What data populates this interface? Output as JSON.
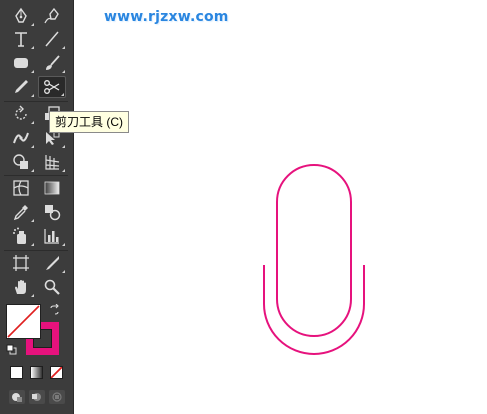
{
  "watermark": {
    "text": "www.rjzxw.com"
  },
  "tooltip": {
    "text": "剪刀工具 (C)"
  },
  "toolbar": {
    "tools": [
      {
        "name": "pen-tool",
        "icon": "pen-icon"
      },
      {
        "name": "curvature-tool",
        "icon": "curvature-pen-icon"
      },
      {
        "name": "type-tool",
        "icon": "type-icon",
        "glyph": "T"
      },
      {
        "name": "line-segment-tool",
        "icon": "line-icon"
      },
      {
        "name": "rectangle-tool",
        "icon": "rounded-rect-icon"
      },
      {
        "name": "paintbrush-tool",
        "icon": "brush-icon"
      },
      {
        "name": "pencil-tool",
        "icon": "pencil-icon"
      },
      {
        "name": "scissors-tool",
        "icon": "scissors-icon",
        "active": true
      },
      {
        "name": "rotate-tool",
        "icon": "rotate-icon"
      },
      {
        "name": "scale-tool",
        "icon": "scale-icon"
      },
      {
        "name": "width-tool",
        "icon": "width-icon"
      },
      {
        "name": "free-transform-tool",
        "icon": "free-transform-icon"
      },
      {
        "name": "shape-builder-tool",
        "icon": "shape-builder-icon"
      },
      {
        "name": "perspective-grid-tool",
        "icon": "perspective-grid-icon"
      },
      {
        "name": "mesh-tool",
        "icon": "mesh-icon"
      },
      {
        "name": "gradient-tool",
        "icon": "gradient-icon"
      },
      {
        "name": "eyedropper-tool",
        "icon": "eyedropper-icon"
      },
      {
        "name": "blend-tool",
        "icon": "blend-icon"
      },
      {
        "name": "symbol-sprayer-tool",
        "icon": "symbol-sprayer-icon"
      },
      {
        "name": "column-graph-tool",
        "icon": "column-graph-icon"
      },
      {
        "name": "artboard-tool",
        "icon": "artboard-icon"
      },
      {
        "name": "slice-tool",
        "icon": "slice-icon"
      },
      {
        "name": "hand-tool",
        "icon": "hand-icon"
      },
      {
        "name": "zoom-tool",
        "icon": "zoom-icon"
      }
    ],
    "fill_color": "none",
    "stroke_color": "#e6127d",
    "modes": [
      "color-mode-icon",
      "gradient-mode-icon",
      "none-mode-icon"
    ],
    "draw_modes": [
      "draw-normal-icon",
      "draw-behind-icon",
      "draw-inside-icon"
    ]
  },
  "canvas": {
    "shape": "paperclip-path",
    "stroke_color": "#e6127d"
  }
}
